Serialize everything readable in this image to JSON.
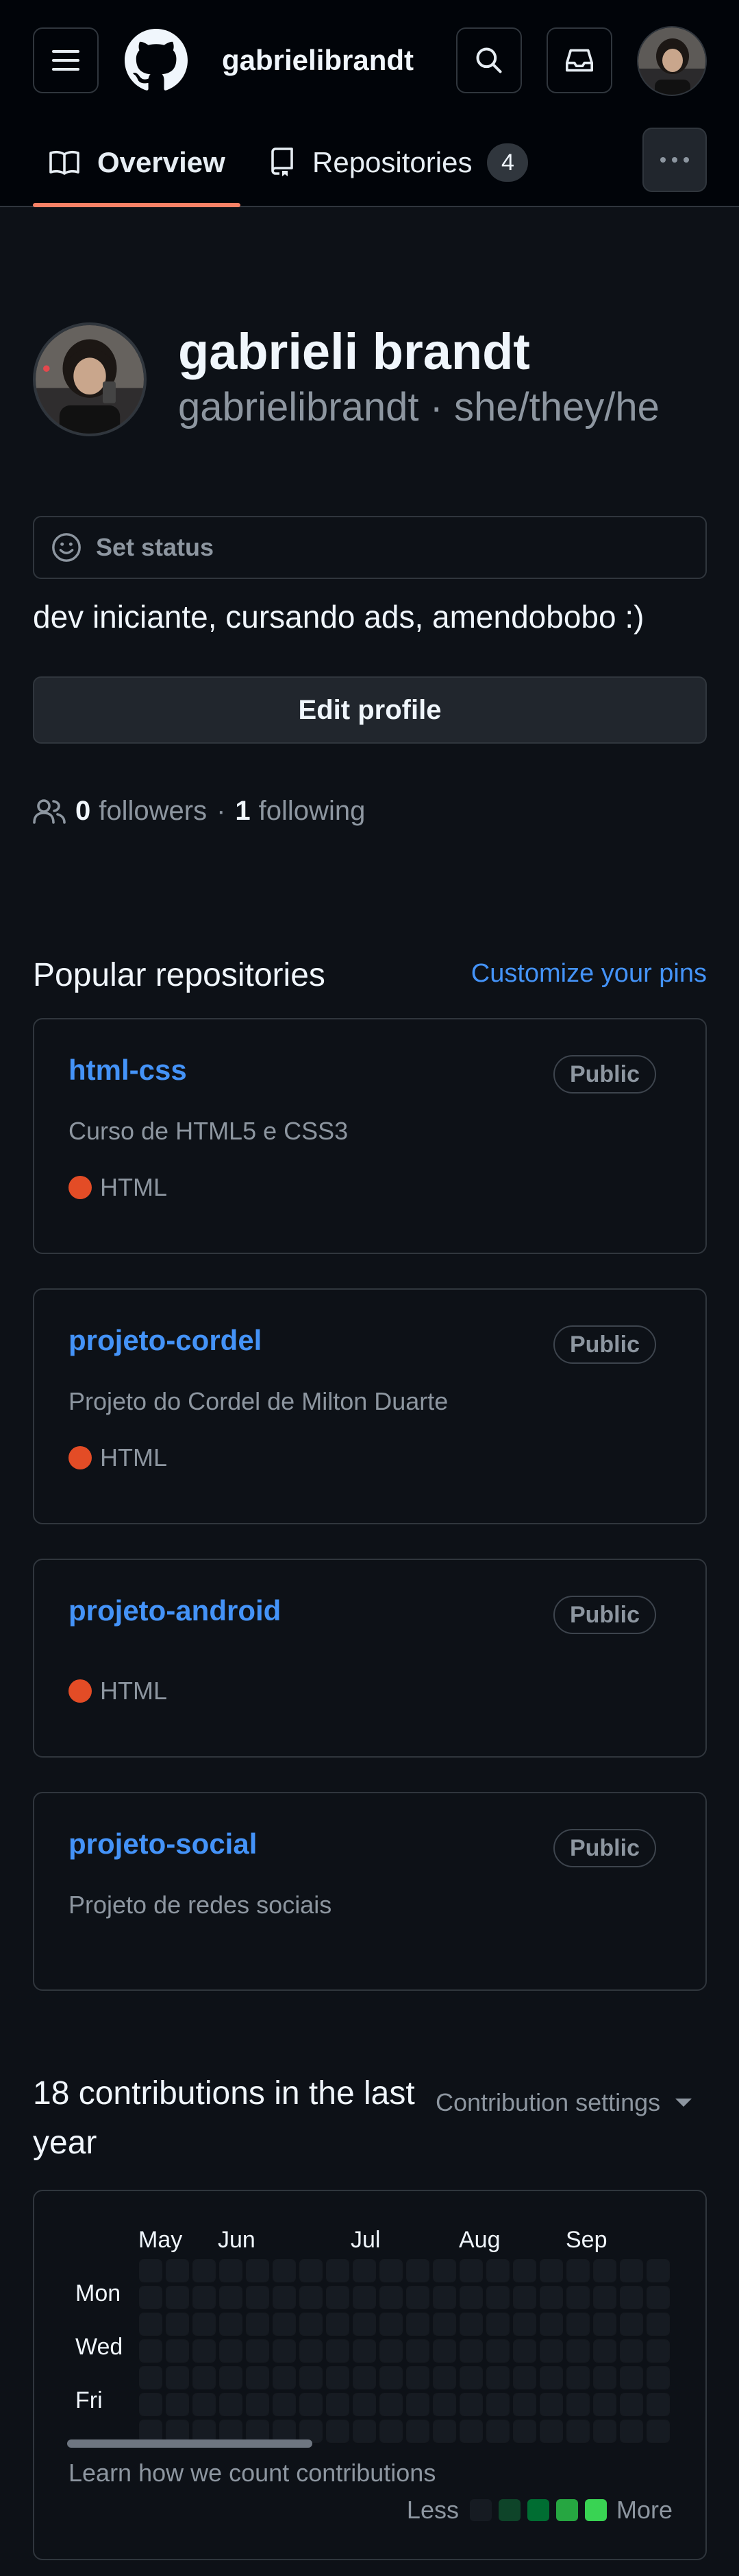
{
  "header": {
    "username": "gabrielibrandt",
    "icons": [
      "hamburger-icon",
      "github-logo",
      "search-icon",
      "inbox-icon",
      "avatar"
    ]
  },
  "tabs": [
    {
      "label": "Overview",
      "icon": "book-icon",
      "active": true
    },
    {
      "label": "Repositories",
      "icon": "repo-icon",
      "count": "4"
    }
  ],
  "profile": {
    "name": "gabrieli brandt",
    "login_line": "gabrielibrandt · she/they/he",
    "status_label": "Set status",
    "bio": "dev iniciante, cursando ads, amendobobo :)",
    "edit_label": "Edit profile",
    "followers_count": "0",
    "followers_label": "followers",
    "following_count": "1",
    "following_label": "following",
    "separator": "·"
  },
  "popular": {
    "title": "Popular repositories",
    "customize": "Customize your pins",
    "repos": [
      {
        "name": "html-css",
        "visibility": "Public",
        "description": "Curso de HTML5 e CSS3",
        "language": "HTML"
      },
      {
        "name": "projeto-cordel",
        "visibility": "Public",
        "description": "Projeto do Cordel de Milton Duarte",
        "language": "HTML"
      },
      {
        "name": "projeto-android",
        "visibility": "Public",
        "description": "",
        "language": "HTML"
      },
      {
        "name": "projeto-social",
        "visibility": "Public",
        "description": "Projeto de redes sociais",
        "language": ""
      }
    ]
  },
  "contributions": {
    "title": "18 contributions in the last year",
    "settings": "Contribution settings",
    "months": [
      "May",
      "Jun",
      "Jul",
      "Aug",
      "Sep"
    ],
    "days": [
      "Mon",
      "Wed",
      "Fri"
    ],
    "learn": "Learn how we count contributions",
    "legend_less": "Less",
    "legend_more": "More",
    "legend_colors": [
      "#161b22",
      "#0e4429",
      "#006d32",
      "#26a641",
      "#39d353"
    ]
  },
  "colors": {
    "background": "#0d1117",
    "accent": "#4493f8",
    "tab_underline": "#f78166",
    "html_lang": "#e34c26"
  }
}
